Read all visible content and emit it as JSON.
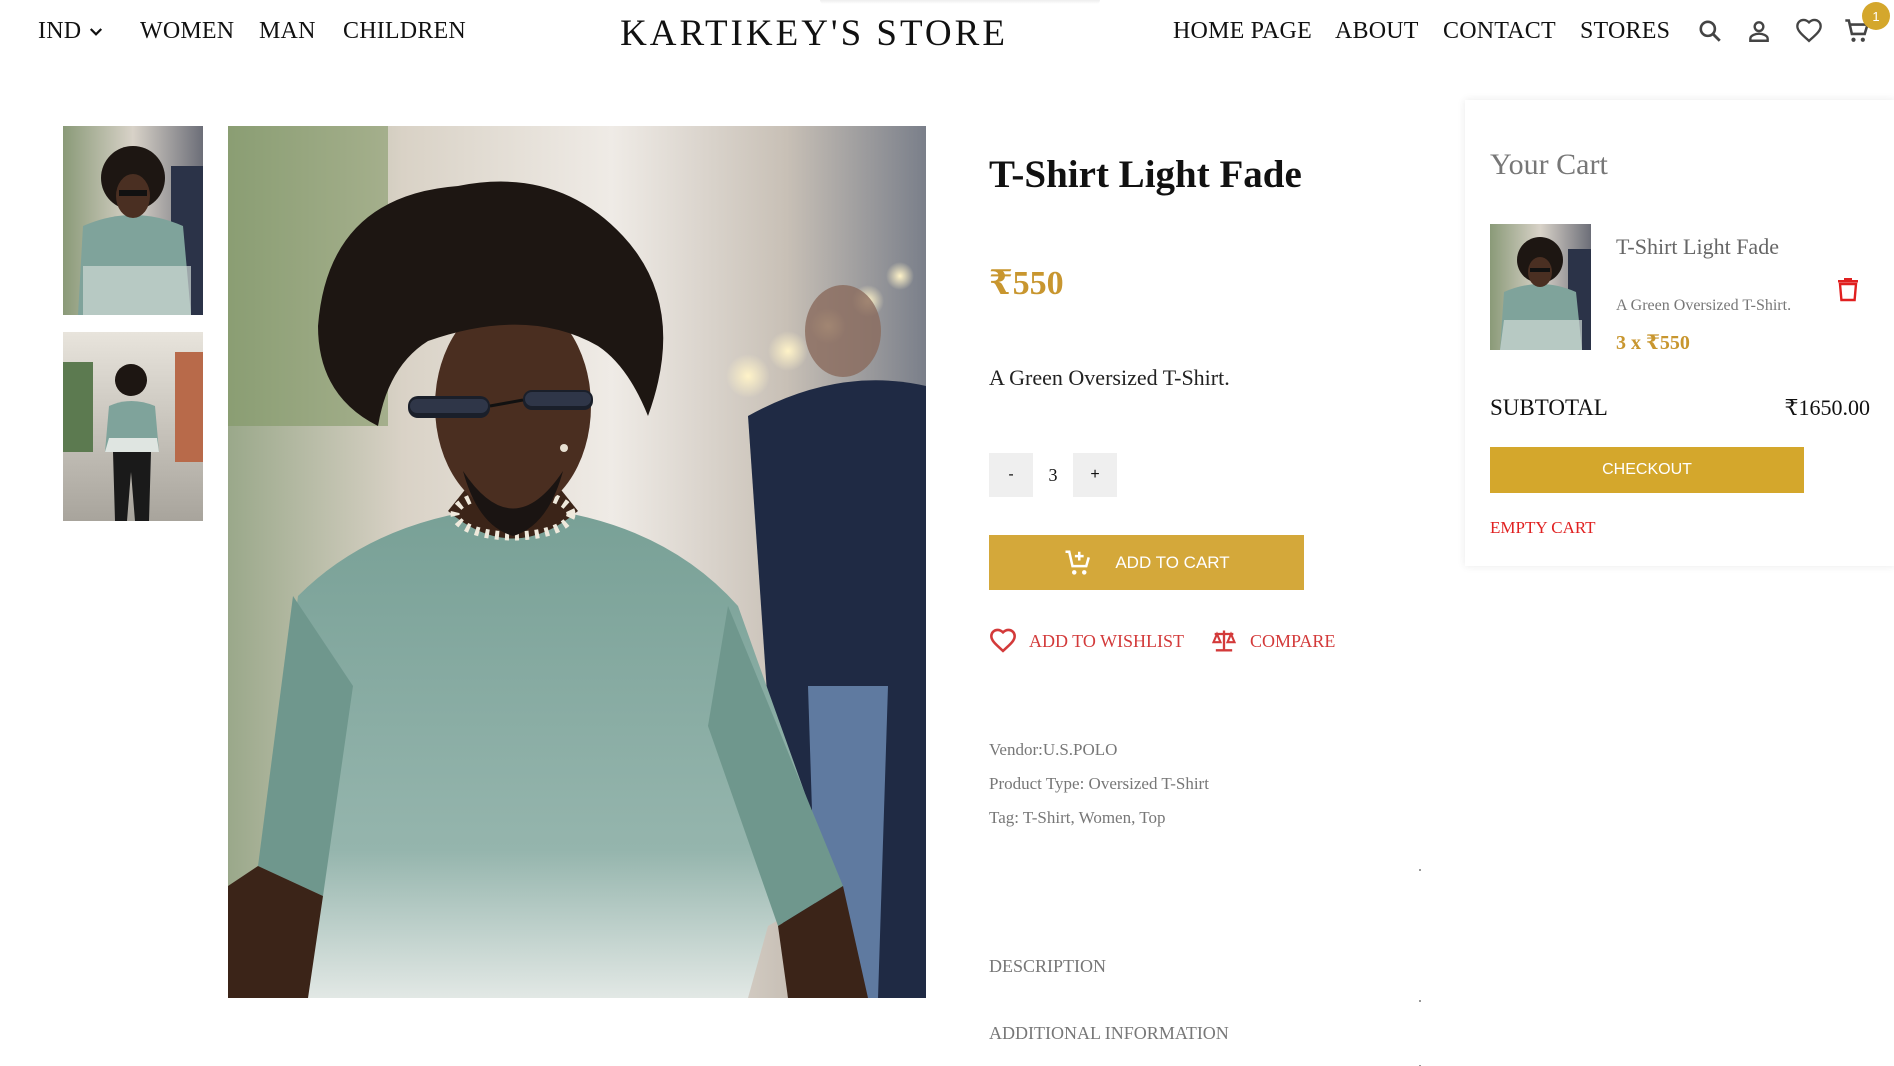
{
  "header": {
    "region": "IND",
    "nav_left": [
      "WOMEN",
      "MAN",
      "CHILDREN"
    ],
    "brand": "KARTIKEY'S STORE",
    "nav_right": [
      "HOME PAGE",
      "ABOUT",
      "CONTACT",
      "STORES"
    ],
    "cart_count": "1"
  },
  "product": {
    "title": "T-Shirt Light Fade",
    "price": "₹550",
    "short_description": "A Green Oversized T-Shirt.",
    "quantity": "3",
    "qty_minus": "-",
    "qty_plus": "+",
    "add_to_cart_label": "ADD TO CART",
    "wishlist_label": "ADD TO WISHLIST",
    "compare_label": "COMPARE",
    "vendor": "Vendor:U.S.POLO",
    "product_type": "Product Type: Oversized T-Shirt",
    "tags": "Tag: T-Shirt, Women, Top",
    "accordion": [
      "DESCRIPTION",
      "ADDITIONAL INFORMATION"
    ]
  },
  "cart": {
    "title": "Your Cart",
    "item_name": "T-Shirt Light Fade",
    "item_description": "A Green Oversized T-Shirt.",
    "item_qty_price": "3 x ₹550",
    "subtotal_label": "SUBTOTAL",
    "subtotal_value": "₹1650.00",
    "checkout_label": "CHECKOUT",
    "empty_cart_label": "EMPTY CART"
  },
  "icons": [
    "chevron-down-icon",
    "search-icon",
    "user-icon",
    "heart-icon",
    "cart-icon",
    "add-cart-icon",
    "scale-icon",
    "trash-icon"
  ],
  "colors": {
    "accent_gold": "#d4a72c",
    "price_gold": "#c8962f",
    "link_red": "#d33a3a",
    "shirt_green": "#7fa39b"
  }
}
